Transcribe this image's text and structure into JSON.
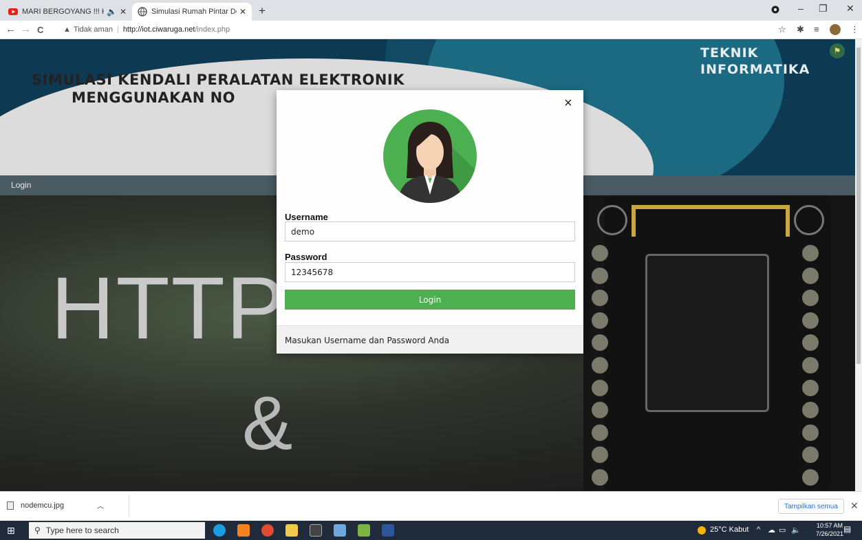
{
  "browser": {
    "tabs": [
      {
        "title": "MARI BERGOYANG !!! KOMP",
        "audio_icon": "speaker-icon"
      },
      {
        "title": "Simulasi Rumah Pintar Dengan N",
        "active": true
      }
    ],
    "new_tab": "+",
    "window": {
      "minimize": "–",
      "restore": "❐",
      "close": "✕"
    },
    "nav": {
      "back": "←",
      "forward": "→",
      "reload": "C"
    },
    "security_label": "Tidak aman",
    "url_host": "http://iot.ciwaruga.net",
    "url_path": "/index.php"
  },
  "header": {
    "title_line1": "SIMULASI KENDALI PERALATAN ELEKTRONIK",
    "title_line2": "MENGGUNAKAN NO",
    "right_line1": "TEKNIK",
    "right_line2": "INFORMATIKA"
  },
  "navbar": {
    "login_label": "Login"
  },
  "hero": {
    "big_text": "HTTP",
    "amp": "&"
  },
  "modal": {
    "close": "×",
    "username_label": "Username",
    "username_value": "demo",
    "password_label": "Password",
    "password_value": "12345678",
    "login_button": "Login",
    "footer_text": "Masukan Username dan Password Anda"
  },
  "downloads": {
    "file_name": "nodemcu.jpg",
    "show_all": "Tampilkan semua",
    "close": "✕"
  },
  "taskbar": {
    "search_placeholder": "Type here to search",
    "weather": "25°C Kabut",
    "time": "10:57 AM",
    "date": "7/26/2021"
  },
  "colors": {
    "accent_green": "#4caf50",
    "header_dark": "#0d3a52",
    "navbar": "#4a5a62"
  }
}
